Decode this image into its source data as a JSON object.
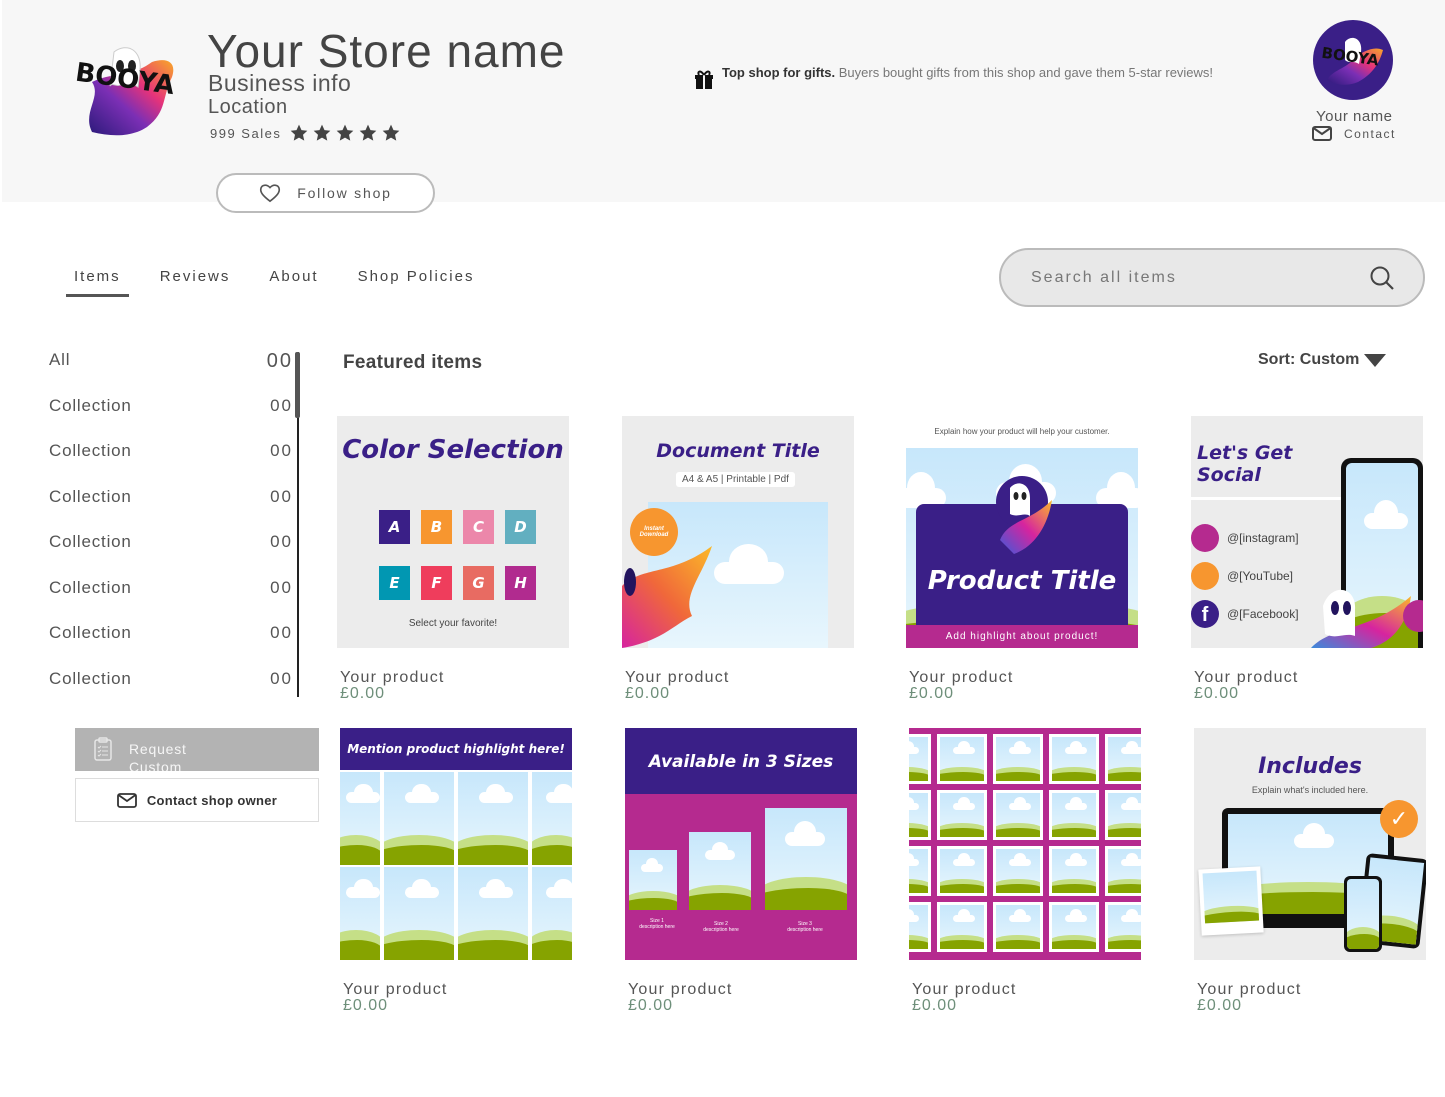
{
  "header": {
    "store_name": "Your Store name",
    "business_info": "Business info",
    "location": "Location",
    "sales": "999 Sales",
    "rating_stars": 5,
    "follow_label": "Follow shop",
    "gift_bold": "Top shop for gifts.",
    "gift_text": " Buyers bought gifts from this shop and gave them 5-star reviews!",
    "logo_text": "BOOYA",
    "owner_name": "Your name",
    "contact_label": "Contact"
  },
  "tabs": [
    {
      "label": "Items",
      "active": true
    },
    {
      "label": "Reviews",
      "active": false
    },
    {
      "label": "About",
      "active": false
    },
    {
      "label": "Shop Policies",
      "active": false
    }
  ],
  "search": {
    "placeholder": "Search all items"
  },
  "sidebar": {
    "items": [
      {
        "label": "All",
        "count": "00"
      },
      {
        "label": "Collection",
        "count": "00"
      },
      {
        "label": "Collection",
        "count": "00"
      },
      {
        "label": "Collection",
        "count": "00"
      },
      {
        "label": "Collection",
        "count": "00"
      },
      {
        "label": "Collection",
        "count": "00"
      },
      {
        "label": "Collection",
        "count": "00"
      },
      {
        "label": "Collection",
        "count": "00"
      }
    ],
    "custom_order_label": "Request Custom Order",
    "contact_owner_label": "Contact shop owner"
  },
  "main": {
    "featured_title": "Featured items",
    "sort_label": "Sort: Custom",
    "products": [
      {
        "name": "Your product",
        "price": "£0.00",
        "thumb_title": "Color Selection",
        "thumb_sub": "Select your favorite!",
        "swatches": [
          "A",
          "B",
          "C",
          "D",
          "E",
          "F",
          "G",
          "H"
        ]
      },
      {
        "name": "Your product",
        "price": "£0.00",
        "thumb_title": "Document Title",
        "thumb_sub": "A4 & A5 | Printable | Pdf",
        "badge": "Instant Download"
      },
      {
        "name": "Your product",
        "price": "£0.00",
        "thumb_title": "Product Title",
        "thumb_top": "Explain how your product will  help your customer.",
        "thumb_sub": "Add highlight about product!"
      },
      {
        "name": "Your product",
        "price": "£0.00",
        "thumb_title": "Let's Get Social",
        "socials": [
          "@[instagram]",
          "@[YouTube]",
          "@[Facebook]"
        ]
      },
      {
        "name": "Your product",
        "price": "£0.00",
        "thumb_title": "Mention product highlight here!"
      },
      {
        "name": "Your product",
        "price": "£0.00",
        "thumb_title": "Available in 3 Sizes",
        "sizes": [
          "Size 1 description here",
          "Size 2 description here",
          "Size 3 description here"
        ]
      },
      {
        "name": "Your product",
        "price": "£0.00"
      },
      {
        "name": "Your product",
        "price": "£0.00",
        "thumb_title": "Includes",
        "thumb_sub": "Explain what's included here."
      }
    ]
  },
  "colors": {
    "brand_purple": "#3a1f87",
    "magenta": "#b52a8f",
    "orange": "#f7962f",
    "swatches": [
      "#3a1f87",
      "#f7962f",
      "#ec87aa",
      "#62afc0",
      "#0197b2",
      "#ef3d5c",
      "#e86b62",
      "#b12b8f"
    ]
  }
}
